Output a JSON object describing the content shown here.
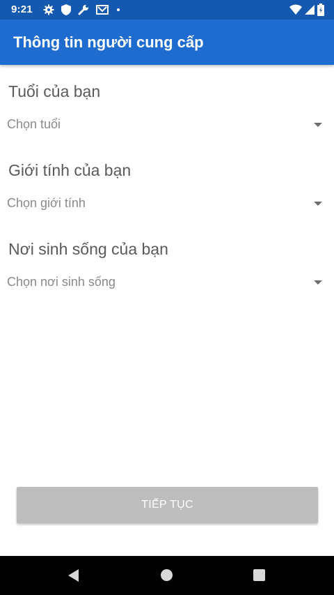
{
  "status_bar": {
    "time": "9:21",
    "left_icons": [
      "gear-icon",
      "shield-icon",
      "wrench-icon",
      "mail-icon",
      "dot-icon"
    ],
    "right_icons": [
      "wifi-icon",
      "cell-signal-icon",
      "battery-icon"
    ],
    "background": "#1558b0"
  },
  "app_bar": {
    "title": "Thông tin người cung cấp",
    "background": "#1f6cd0"
  },
  "form": {
    "age": {
      "label": "Tuổi của bạn",
      "placeholder": "Chọn tuổi"
    },
    "gender": {
      "label": "Giới tính của bạn",
      "placeholder": "Chọn giới tính"
    },
    "birthplace": {
      "label": "Nơi sinh sống của bạn",
      "placeholder": "Chọn nơi sinh sống"
    }
  },
  "continue_button": {
    "label": "TIẾP TỤC",
    "state": "disabled"
  },
  "nav_bar": {
    "buttons": [
      "back-icon",
      "home-icon",
      "recents-icon"
    ]
  }
}
